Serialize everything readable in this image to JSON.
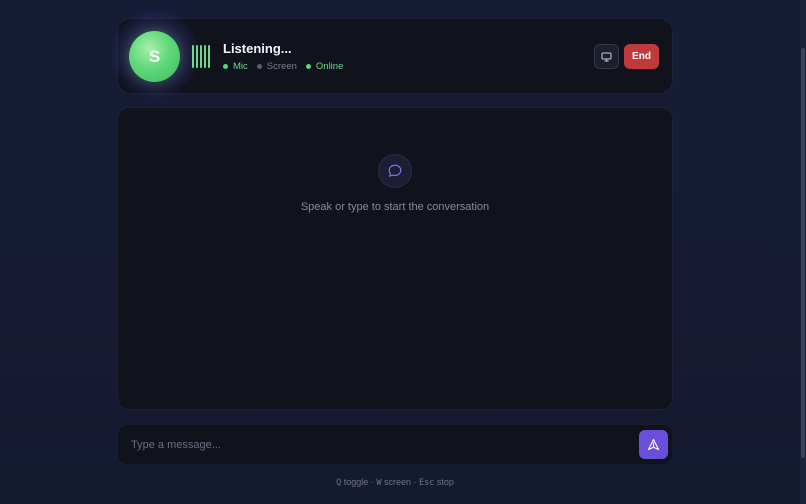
{
  "header": {
    "avatar_initial": "S",
    "status_title": "Listening...",
    "indicators": [
      {
        "label": "Mic",
        "active": true
      },
      {
        "label": "Screen",
        "active": false
      },
      {
        "label": "Online",
        "active": true
      }
    ],
    "screen_button_icon": "monitor-icon",
    "end_label": "End"
  },
  "chat": {
    "empty_icon": "chat-bubble-icon",
    "empty_text": "Speak or type to start the conversation"
  },
  "composer": {
    "placeholder": "Type a message...",
    "send_icon": "send-icon"
  },
  "hints": {
    "q_key": "Q",
    "q_text": "toggle",
    "w_key": "W",
    "w_text": "screen",
    "esc_key": "Esc",
    "esc_text": "stop",
    "separator": "·"
  },
  "colors": {
    "accent": "#6a4fd8",
    "active_green": "#5ed47a",
    "danger": "#c0393b"
  }
}
